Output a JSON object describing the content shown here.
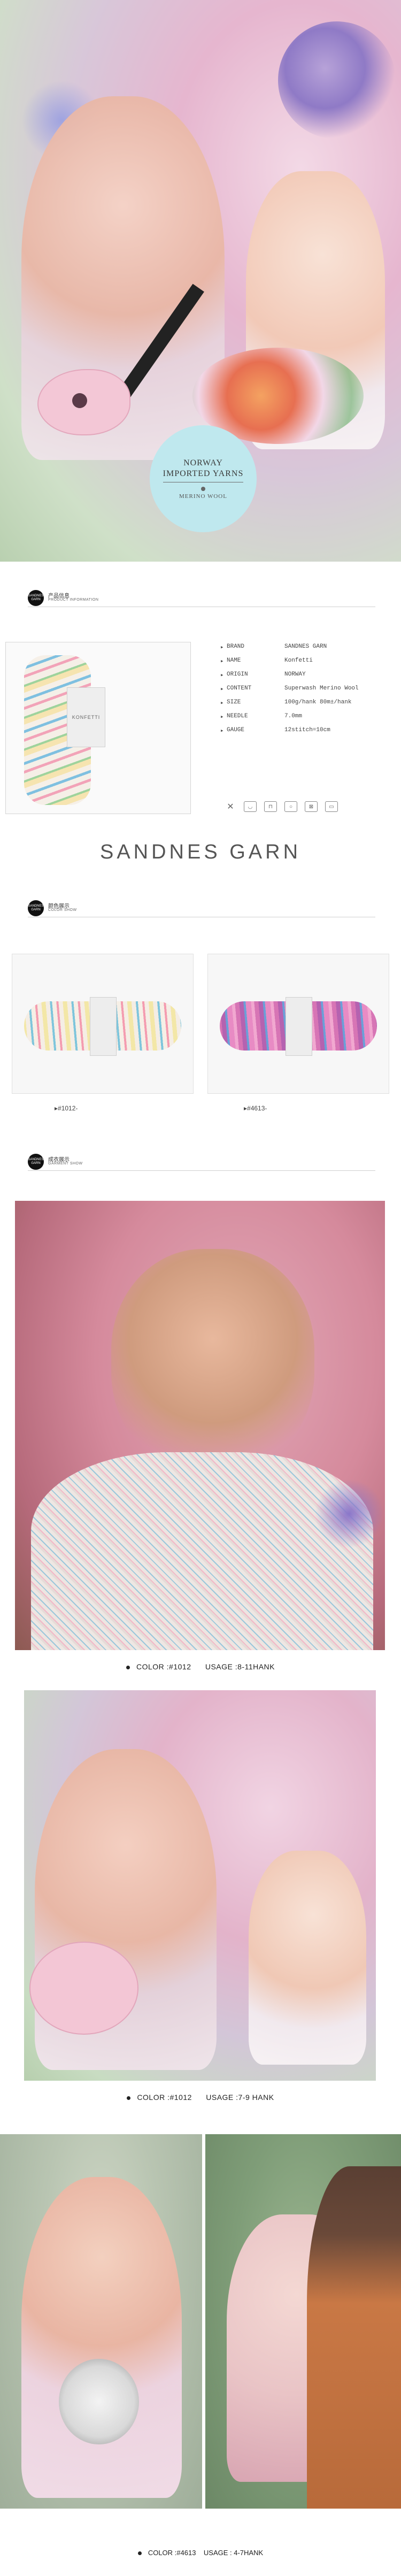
{
  "hero": {
    "badge_line1": "NORWAY",
    "badge_line2": "IMPORTED YARNS",
    "badge_line3": "MERINO WOOL"
  },
  "sections": {
    "product_info": {
      "logo": "SANDNES GARN",
      "zh": "产品信息",
      "en": "PRODUCT INFORMATION"
    },
    "color_show": {
      "logo": "SANDNES GARN",
      "zh": "颜色展示",
      "en": "COLOR SHOW"
    },
    "garment_show": {
      "logo": "SANDNES GARN",
      "zh": "成衣展示",
      "en": "GARMENT SHOW"
    }
  },
  "product": {
    "label_text": "KONFETTI",
    "rows": [
      {
        "k": "BRAND",
        "v": "SANDNES GARN"
      },
      {
        "k": "NAME",
        "v": "Konfetti"
      },
      {
        "k": "ORIGIN",
        "v": "NORWAY"
      },
      {
        "k": "CONTENT",
        "v": "Superwash Merino Wool"
      },
      {
        "k": "SIZE",
        "v": "100g/hank  80m±/hank"
      },
      {
        "k": "NEEDLE",
        "v": "7.0mm"
      },
      {
        "k": "GAUGE",
        "v": "12stitch=10cm"
      }
    ],
    "arrow": "▸",
    "care_icons": [
      "no-bleach-icon",
      "handwash-icon",
      "iron-icon",
      "dryclean-icon",
      "no-tumble-icon",
      "flat-dry-icon"
    ]
  },
  "brand_wordmark": "SANDNES GARN",
  "colors": [
    {
      "code": "#1012-"
    },
    {
      "code": "#4613-"
    }
  ],
  "captions": {
    "cap1": {
      "color": "COLOR :#1012",
      "usage": "USAGE :8-11HANK"
    },
    "cap2": {
      "color": "COLOR :#1012",
      "usage": "USAGE :7-9 HANK"
    },
    "cap3": {
      "color": "COLOR :#4613",
      "usage": "USAGE : 4-7HANK"
    }
  }
}
